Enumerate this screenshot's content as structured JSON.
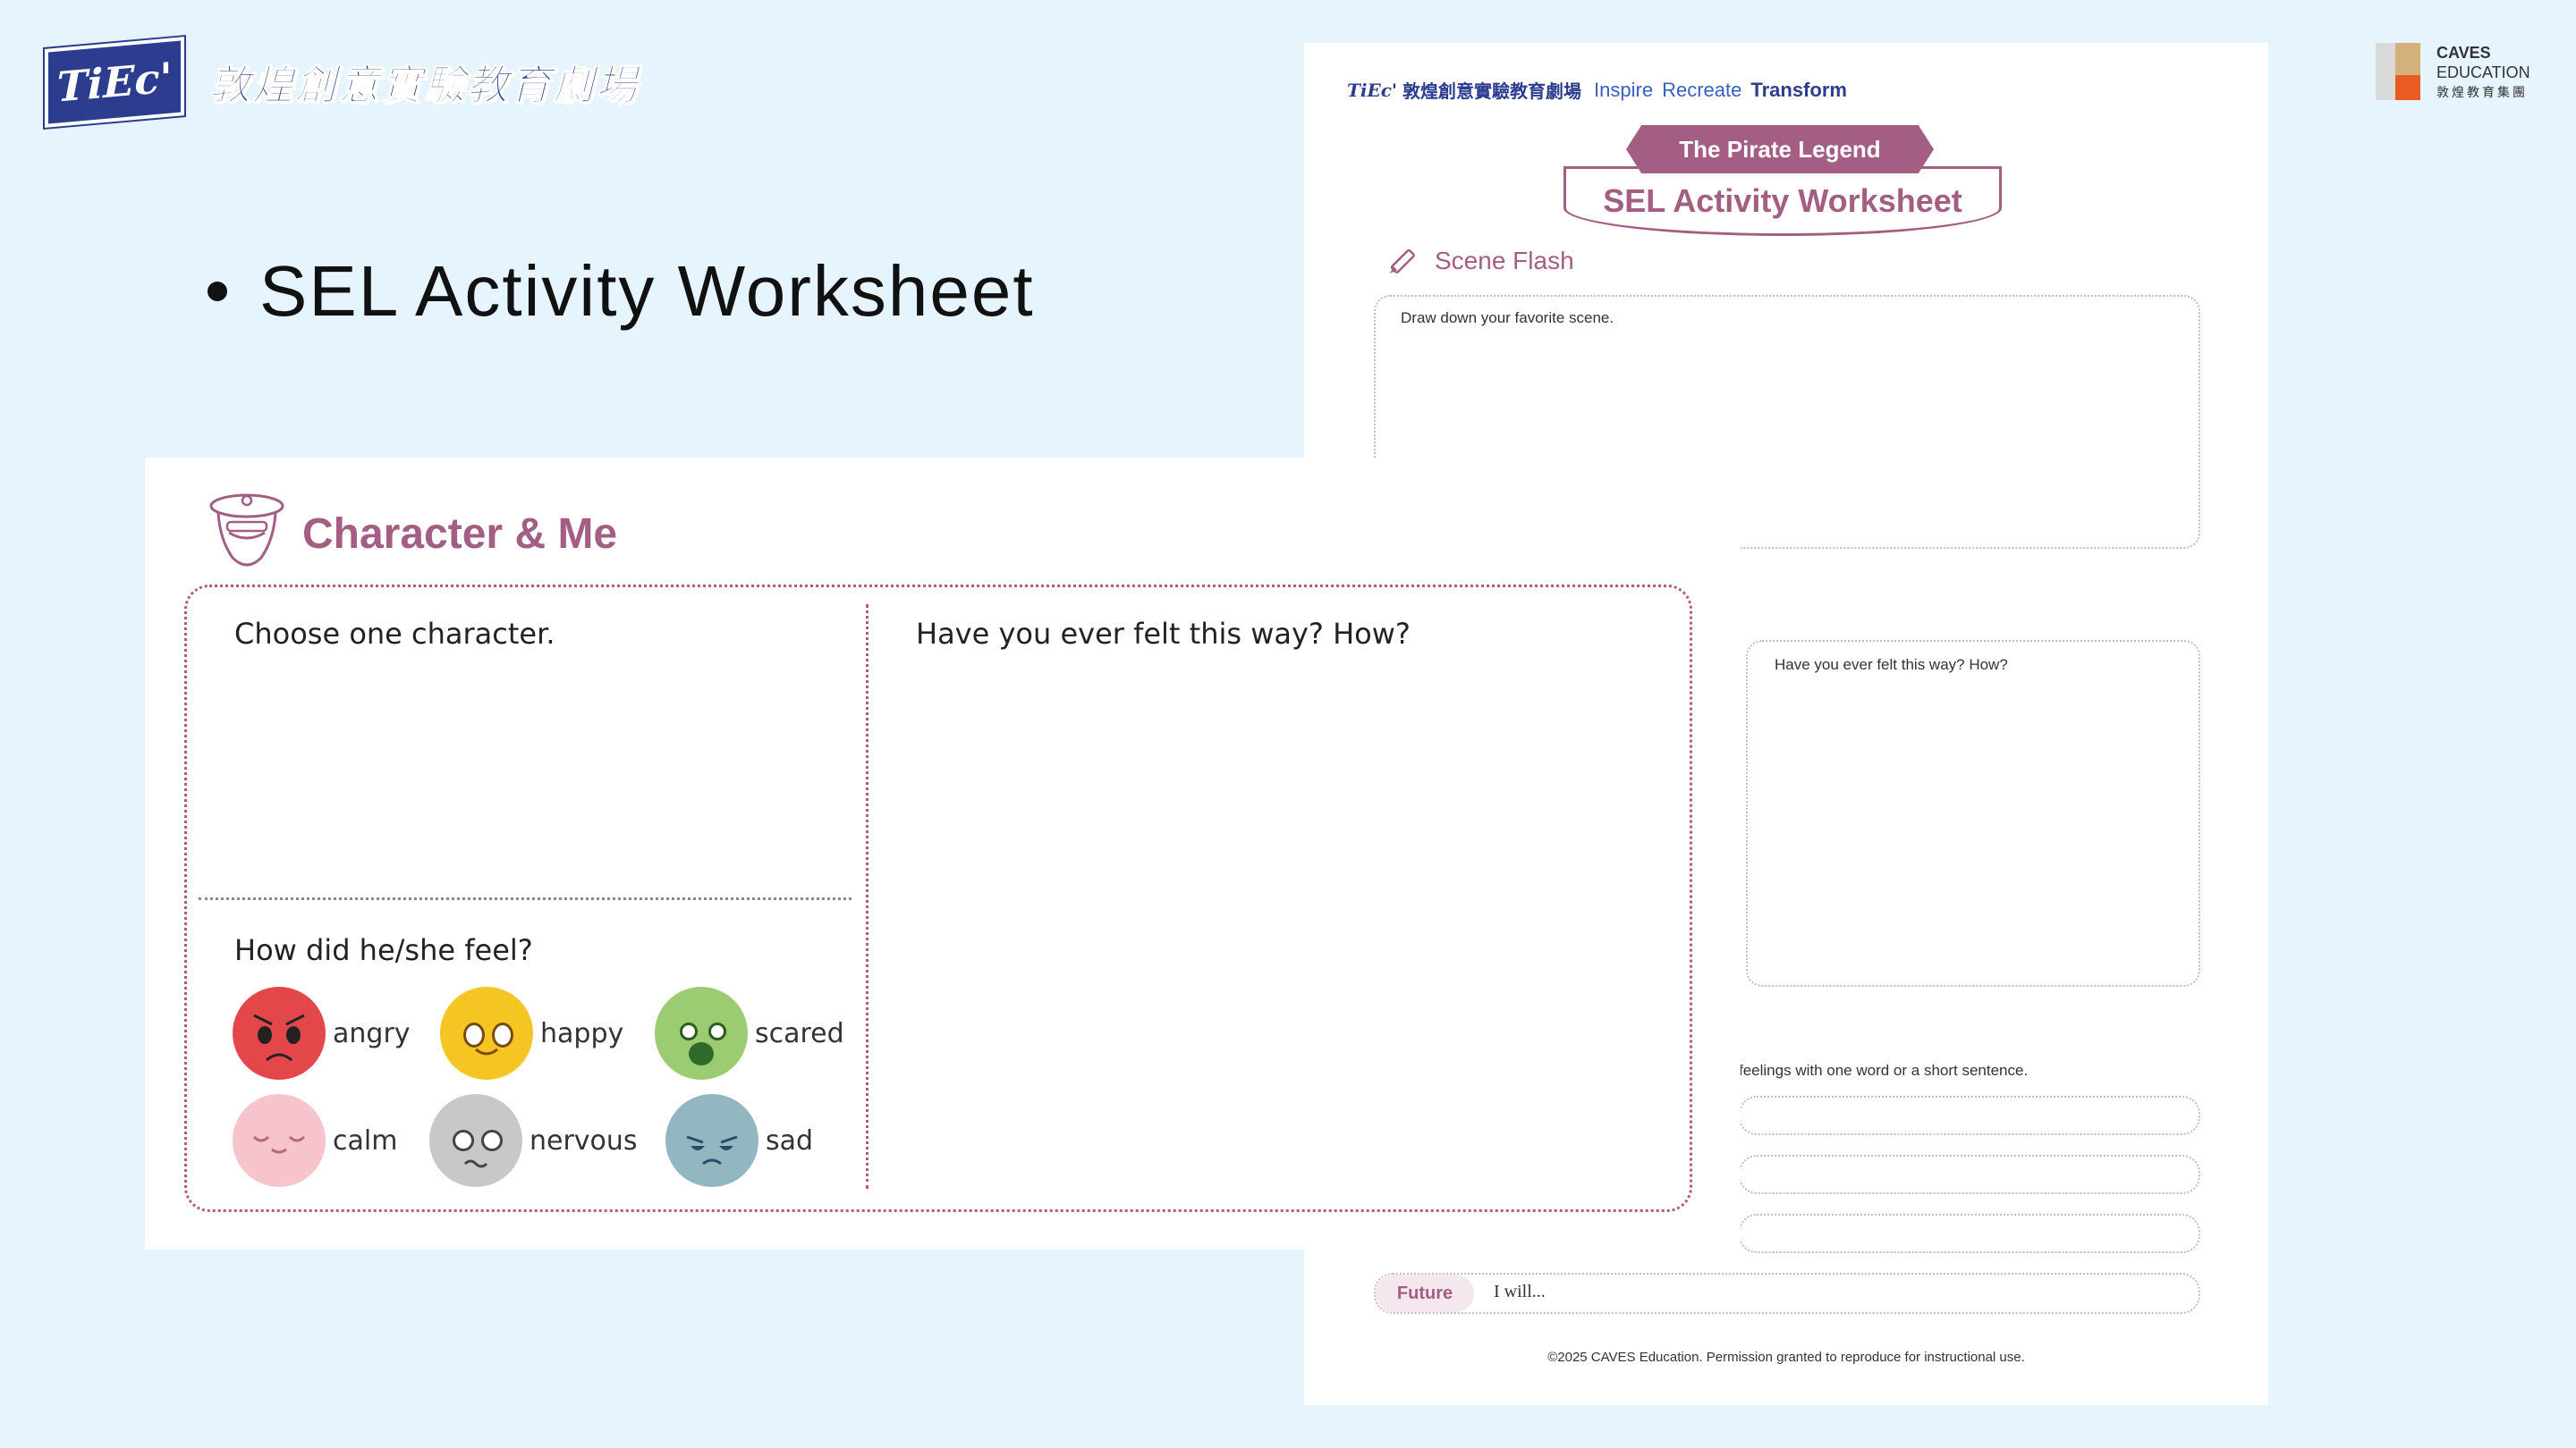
{
  "brand": {
    "badge": "TiEc'",
    "cn_name": "敦煌創意實驗教育劇場"
  },
  "caves": {
    "line1": "CAVES",
    "line2": "EDUCATION",
    "line3": "敦煌教育集團",
    "colors": [
      "#d4b07a",
      "#ea5b22",
      "#d9d9d9"
    ]
  },
  "slide": {
    "heading": "SEL Activity Worksheet"
  },
  "worksheet": {
    "header_logo": "TiEc'",
    "header_cn": "敦煌創意實驗教育劇場",
    "tagline": [
      "Inspire",
      "Recreate",
      "Transform"
    ],
    "banner_top": "The Pirate Legend",
    "banner_main": "SEL Activity Worksheet",
    "scene_title": "Scene Flash",
    "scene_prompt": "Draw down your favorite scene.",
    "felt_prompt": "Have you ever felt this way? How?",
    "feelings_prompt": "feelings with one word or a short sentence.",
    "future_label": "Future",
    "future_text": "I will...",
    "copyright": "©2025 CAVES Education. Permission granted to reproduce for instructional use."
  },
  "card": {
    "title": "Character & Me",
    "choose_prompt": "Choose one character.",
    "felt_prompt": "Have you ever felt this way? How?",
    "feel_prompt": "How did he/she feel?",
    "emotions": [
      {
        "label": "angry",
        "color": "#e4474a"
      },
      {
        "label": "happy",
        "color": "#f5c623"
      },
      {
        "label": "scared",
        "color": "#9ccc72"
      },
      {
        "label": "calm",
        "color": "#f7c3cc"
      },
      {
        "label": "nervous",
        "color": "#c8c8c8"
      },
      {
        "label": "sad",
        "color": "#93b7c0"
      }
    ]
  },
  "colors": {
    "background": "#e6f4fd",
    "accent": "#a45e84",
    "brand_blue": "#2c3d8f"
  }
}
